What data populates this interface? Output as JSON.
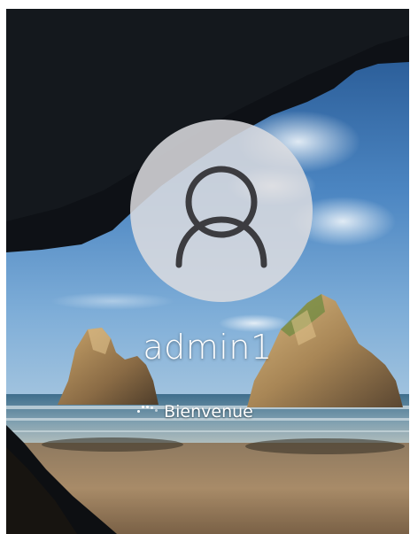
{
  "screen": {
    "type": "windows-lock-screen-signing-in"
  },
  "user": {
    "name": "admin1",
    "avatar_icon": "user-silhouette-icon"
  },
  "status": {
    "text": "Bienvenue",
    "spinner_icon": "loading-spinner-icon"
  }
}
